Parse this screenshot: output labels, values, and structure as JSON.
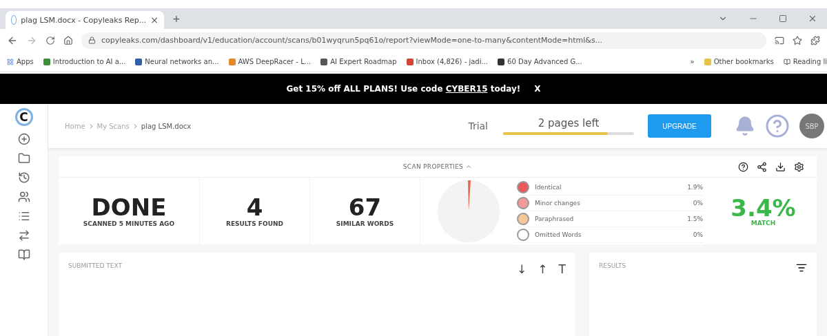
{
  "browser": {
    "tab": {
      "title": "plag LSM.docx - Copyleaks Rep...",
      "close": "×"
    },
    "new_tab": "+",
    "url": "copyleaks.com/dashboard/v1/education/account/scans/b01wyqrun5pq61o/report?viewMode=one-to-many&contentMode=html&s...",
    "bookmarks": [
      {
        "label": "Apps"
      },
      {
        "label": "Introduction to AI a...",
        "color": "#3b8f3b"
      },
      {
        "label": "Neural networks an...",
        "color": "#2f5fa8"
      },
      {
        "label": "AWS DeepRacer - L...",
        "color": "#e8862a"
      },
      {
        "label": "AI Expert Roadmap",
        "color": "#555555"
      },
      {
        "label": "Inbox (4,826) - jadi...",
        "color": "#d44638"
      },
      {
        "label": "60 Day Advanced G...",
        "color": "#333333"
      }
    ],
    "more": "»",
    "other_bookmarks": "Other bookmarks",
    "reading_list": "Reading li"
  },
  "banner": {
    "text": "Get 15% off ALL PLANS! Use code ",
    "code": "CYBER15",
    "after": " today!",
    "close": "X"
  },
  "app_logo": "C",
  "header": {
    "breadcrumbs": [
      "Home",
      "My Scans",
      "plag LSM.docx"
    ],
    "plan": "Trial",
    "pages_left": "2 pages left",
    "level": 0.8,
    "upgrade": "UPGRADE",
    "avatar": "SBP"
  },
  "scan_properties": {
    "title": "SCAN PROPERTIES",
    "stats": [
      {
        "value": "DONE",
        "label": "SCANNED 5 MINUTES AGO"
      },
      {
        "value": "4",
        "label": "RESULTS FOUND"
      },
      {
        "value": "67",
        "label": "SIMILAR WORDS"
      }
    ],
    "legend": [
      {
        "label": "Identical",
        "value": "1.9%",
        "color": "#e85a5a"
      },
      {
        "label": "Minor changes",
        "value": "0%",
        "color": "#f29a9a"
      },
      {
        "label": "Paraphrased",
        "value": "1.5%",
        "color": "#f6c899"
      },
      {
        "label": "Omitted Words",
        "value": "0%",
        "color": "#ffffff"
      }
    ],
    "match": {
      "value": "3.4%",
      "label": "MATCH"
    }
  },
  "submitted_text": {
    "title": "SUBMITTED TEXT",
    "tools": [
      "↓",
      "↑",
      "T"
    ]
  },
  "results": {
    "title": "RESULTS"
  }
}
